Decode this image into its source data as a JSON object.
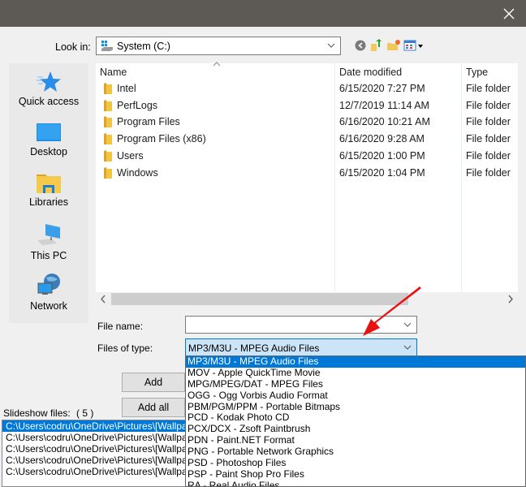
{
  "window": {
    "close_icon": "close-icon"
  },
  "lookin": {
    "label": "Look in:",
    "value": "System (C:)",
    "drive_icon": "windows-drive-icon"
  },
  "toolbar": {
    "icons": [
      "back-icon",
      "up-folder-icon",
      "new-folder-icon",
      "view-menu-icon"
    ]
  },
  "places": [
    {
      "label": "Quick access",
      "icon": "star-icon"
    },
    {
      "label": "Desktop",
      "icon": "desktop-icon"
    },
    {
      "label": "Libraries",
      "icon": "libraries-icon"
    },
    {
      "label": "This PC",
      "icon": "computer-icon"
    },
    {
      "label": "Network",
      "icon": "network-icon"
    }
  ],
  "filelist": {
    "columns": [
      "Name",
      "Date modified",
      "Type"
    ],
    "rows": [
      {
        "name": "Intel",
        "date": "6/15/2020 7:27 PM",
        "type": "File folder"
      },
      {
        "name": "PerfLogs",
        "date": "12/7/2019 11:14 AM",
        "type": "File folder"
      },
      {
        "name": "Program Files",
        "date": "6/16/2020 10:21 AM",
        "type": "File folder"
      },
      {
        "name": "Program Files (x86)",
        "date": "6/16/2020 9:28 AM",
        "type": "File folder"
      },
      {
        "name": "Users",
        "date": "6/15/2020 1:00 PM",
        "type": "File folder"
      },
      {
        "name": "Windows",
        "date": "6/15/2020 1:04 PM",
        "type": "File folder"
      }
    ],
    "hscroll_fraction": 0.76
  },
  "form": {
    "filename_label": "File name:",
    "filename_value": "",
    "filetype_label": "Files of type:",
    "filetype_value": "MP3/M3U - MPEG Audio Files"
  },
  "filetype_options": [
    "MP3/M3U - MPEG Audio Files",
    "MOV - Apple QuickTime Movie",
    "MPG/MPEG/DAT - MPEG Files",
    "OGG - Ogg Vorbis Audio Format",
    "PBM/PGM/PPM - Portable Bitmaps",
    "PCD - Kodak Photo CD",
    "PCX/DCX - Zsoft Paintbrush",
    "PDN - Paint.NET Format",
    "PNG - Portable Network Graphics",
    "PSD - Photoshop Files",
    "PSP - Paint Shop Pro Files",
    "RA - Real Audio Files"
  ],
  "buttons": {
    "add": "Add",
    "add_all": "Add all"
  },
  "slideshow": {
    "label": "Slideshow files:",
    "count": "( 5 )",
    "items": [
      "C:\\Users\\codru\\OneDrive\\Pictures\\[Wallpapers]",
      "C:\\Users\\codru\\OneDrive\\Pictures\\[Wallpapers]",
      "C:\\Users\\codru\\OneDrive\\Pictures\\[Wallpapers]",
      "C:\\Users\\codru\\OneDrive\\Pictures\\[Wallpapers]",
      "C:\\Users\\codru\\OneDrive\\Pictures\\[Wallpapers]"
    ]
  },
  "colors": {
    "titlebar": "#5d5955",
    "selection": "#0078d7",
    "annotation_arrow": "#e81010"
  }
}
